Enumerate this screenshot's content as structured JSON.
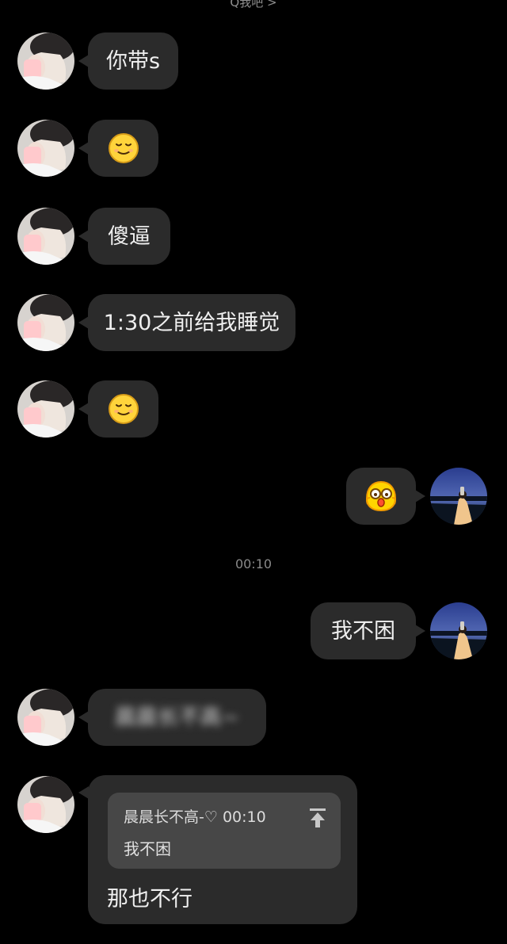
{
  "header": {
    "title_fragment": "Q我吧 >"
  },
  "messages": [
    {
      "side": "left",
      "type": "text",
      "text": "你带s"
    },
    {
      "side": "left",
      "type": "emoji",
      "emoji": "smile-emoji"
    },
    {
      "side": "left",
      "type": "text",
      "text": "傻逼"
    },
    {
      "side": "left",
      "type": "text",
      "text": "1:30之前给我睡觉"
    },
    {
      "side": "left",
      "type": "emoji",
      "emoji": "smile-emoji"
    },
    {
      "side": "right",
      "type": "emoji",
      "emoji": "surprised-emoji"
    },
    {
      "side": "right",
      "type": "text",
      "text": "我不困"
    },
    {
      "side": "left",
      "type": "text",
      "text": "晨晨长不高~",
      "blurred": true
    },
    {
      "side": "left",
      "type": "reply",
      "quote_sender": "晨晨长不高-♡",
      "quote_time": "00:10",
      "quote_text": "我不困",
      "text": "那也不行"
    }
  ],
  "timestamp": "00:10",
  "colors": {
    "background": "#000000",
    "bubble": "#2b2b2b",
    "quote_card": "#474747",
    "timestamp": "#8a8a8a"
  }
}
